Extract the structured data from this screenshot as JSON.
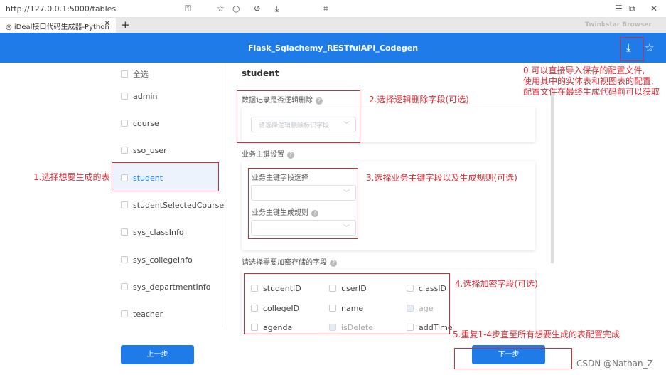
{
  "browser": {
    "url": "http://127.0.0.1:5000/tables",
    "tab_title": "iDeal接口代码生成器-Python",
    "brand": "Twinkstar Browser"
  },
  "header": {
    "title": "Flask_Sqlachemy_RESTfulAPI_Codegen",
    "import_icon": "download-icon",
    "star_icon": "star-icon"
  },
  "sidebar": {
    "items": [
      {
        "label": "全选"
      },
      {
        "label": "admin"
      },
      {
        "label": "course"
      },
      {
        "label": "sso_user"
      },
      {
        "label": "student",
        "selected": true
      },
      {
        "label": "studentSelectedCourse"
      },
      {
        "label": "sys_classInfo"
      },
      {
        "label": "sys_collegeInfo"
      },
      {
        "label": "sys_departmentInfo"
      },
      {
        "label": "teacher"
      }
    ]
  },
  "main": {
    "table_name": "student",
    "logic_delete": {
      "label": "数据记录是否逻辑删除",
      "placeholder": "请选择逻辑删除标识字段"
    },
    "business_key": {
      "label": "业务主键设置",
      "field_label": "业务主键字段选择",
      "rule_label": "业务主键生成规则"
    },
    "encrypt": {
      "label": "请选择需要加密存储的字段",
      "fields": [
        {
          "name": "studentID",
          "disabled": false
        },
        {
          "name": "userID",
          "disabled": false
        },
        {
          "name": "classID",
          "disabled": false
        },
        {
          "name": "collegeID",
          "disabled": false
        },
        {
          "name": "name",
          "disabled": false
        },
        {
          "name": "age",
          "disabled": true
        },
        {
          "name": "agenda",
          "disabled": false
        },
        {
          "name": "isDelete",
          "disabled": true
        },
        {
          "name": "addTime",
          "disabled": false
        }
      ]
    }
  },
  "buttons": {
    "prev": "上一步",
    "next": "下一步"
  },
  "annotations": {
    "n0": [
      "0.可以直接导入保存的配置文件,",
      "使用其中的实体表和视图表的配置,",
      "配置文件在最终生成代码前可以获取"
    ],
    "n1": "1.选择想要生成的表",
    "n2": "2.选择逻辑删除字段(可选)",
    "n3": "3.选择业务主键字段以及生成规则(可选)",
    "n4": "4.选择加密字段(可选)",
    "n5": "5.重复1-4步直至所有想要生成的表配置完成"
  },
  "watermark": "CSDN @Nathan_Z"
}
